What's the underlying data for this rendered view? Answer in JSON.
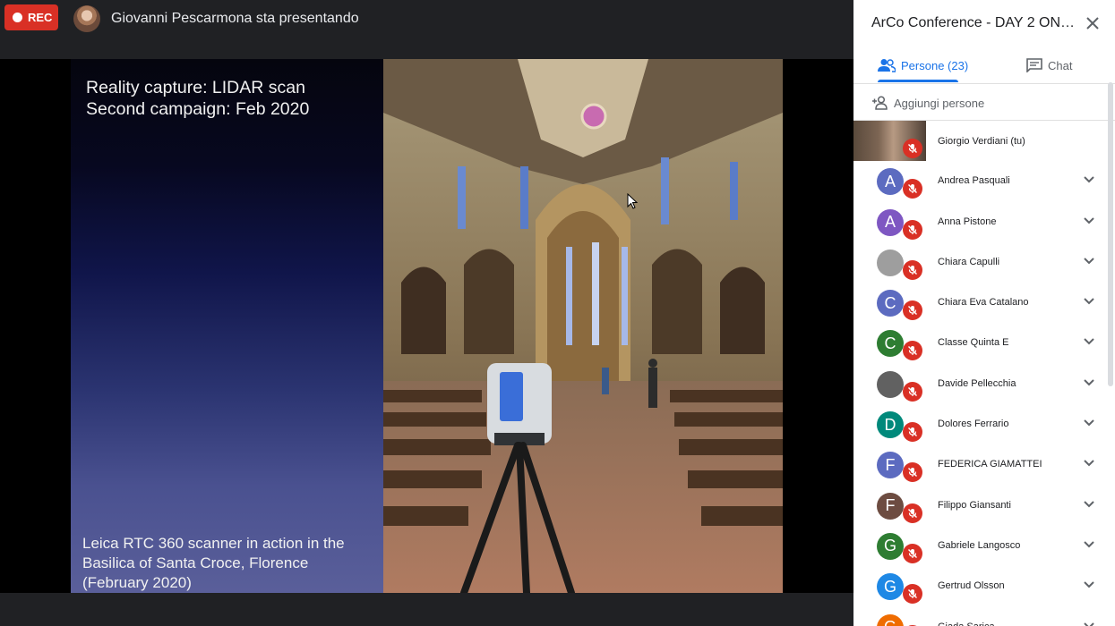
{
  "topbar": {
    "rec_label": "REC",
    "presenter_text": "Giovanni Pescarmona sta presentando"
  },
  "slide": {
    "title_line1": "Reality capture: LIDAR scan",
    "title_line2": "Second campaign: Feb 2020",
    "caption": "Leica RTC 360 scanner in action in the Basilica of Santa Croce, Florence (February 2020)"
  },
  "panel": {
    "title": "ArCo Conference - DAY 2 ONLIN...",
    "tabs": {
      "people": "Persone (23)",
      "chat": "Chat"
    },
    "add_people": "Aggiungi persone",
    "participants": [
      {
        "name": "Giorgio Verdiani (tu)",
        "initial": "",
        "color": ""
      },
      {
        "name": "Andrea Pasquali",
        "initial": "A",
        "color": "#5c6bc0"
      },
      {
        "name": "Anna Pistone",
        "initial": "A",
        "color": "#7e57c2"
      },
      {
        "name": "Chiara Capulli",
        "initial": "",
        "color": "#9e9e9e"
      },
      {
        "name": "Chiara Eva Catalano",
        "initial": "C",
        "color": "#5c6bc0"
      },
      {
        "name": "Classe Quinta E",
        "initial": "C",
        "color": "#2e7d32"
      },
      {
        "name": "Davide Pellecchia",
        "initial": "",
        "color": "#616161"
      },
      {
        "name": "Dolores Ferrario",
        "initial": "D",
        "color": "#00897b"
      },
      {
        "name": "FEDERICA GIAMATTEI",
        "initial": "F",
        "color": "#5c6bc0"
      },
      {
        "name": "Filippo Giansanti",
        "initial": "F",
        "color": "#6d4c41"
      },
      {
        "name": "Gabriele Langosco",
        "initial": "G",
        "color": "#2e7d32"
      },
      {
        "name": "Gertrud Olsson",
        "initial": "G",
        "color": "#1e88e5"
      },
      {
        "name": "Giada Sarica",
        "initial": "G",
        "color": "#ef6c00"
      }
    ]
  }
}
